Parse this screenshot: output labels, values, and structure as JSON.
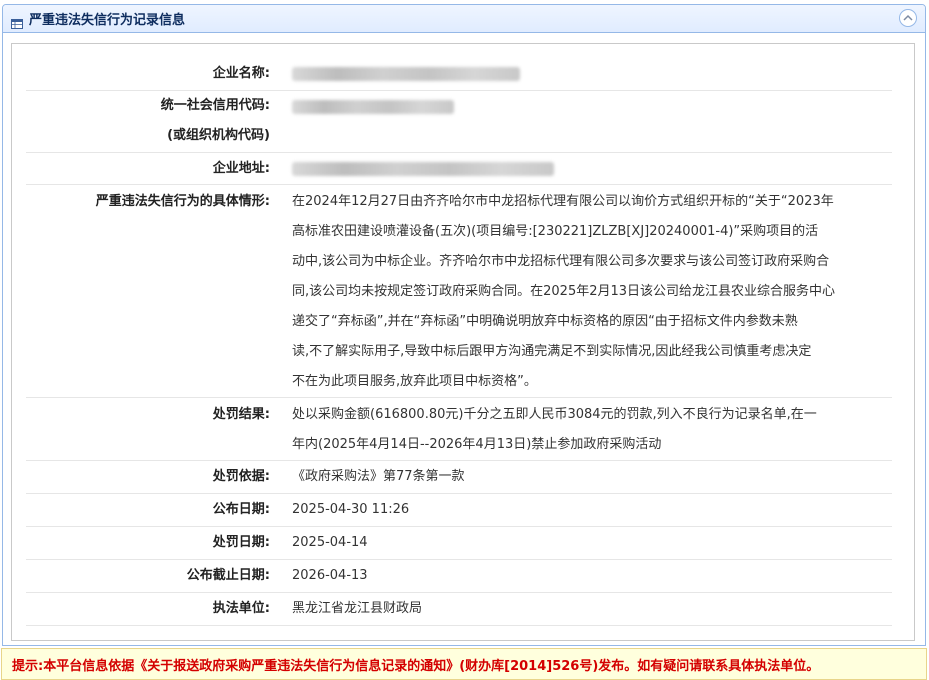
{
  "panel": {
    "title": "严重违法失信行为记录信息",
    "icon": "table-icon",
    "collapse_icon": "chevron-up-icon",
    "border_color": "#95b8e7"
  },
  "fields": [
    {
      "name": "company-name",
      "label": "企业名称:",
      "value": "",
      "redacted": true
    },
    {
      "name": "credit-code",
      "label": "统一社会信用代码:",
      "label2": "(或组织机构代码)",
      "value": "",
      "redacted": true
    },
    {
      "name": "address",
      "label": "企业地址:",
      "value": "",
      "redacted": true
    },
    {
      "name": "details",
      "label": "严重违法失信行为的具体情形:",
      "value_lines": [
        "在2024年12月27日由齐齐哈尔市中龙招标代理有限公司以询价方式组织开标的“关于“2023年",
        "高标准农田建设喷灌设备(五次)(项目编号:[230221]ZLZB[XJ]20240001-4)”采购项目的活",
        "动中,该公司为中标企业。齐齐哈尔市中龙招标代理有限公司多次要求与该公司签订政府采购合",
        "同,该公司均未按规定签订政府采购合同。在2025年2月13日该公司给龙江县农业综合服务中心",
        "递交了“弃标函”,并在“弃标函”中明确说明放弃中标资格的原因“由于招标文件内参数未熟",
        "读,不了解实际用子,导致中标后跟甲方沟通完满足不到实际情况,因此经我公司慎重考虑决定",
        "不在为此项目服务,放弃此项目中标资格”。"
      ]
    },
    {
      "name": "penalty-result",
      "label": "处罚结果:",
      "value_lines": [
        "处以采购金额(616800.80元)千分之五即人民币3084元的罚款,列入不良行为记录名单,在一",
        "年内(2025年4月14日--2026年4月13日)禁止参加政府采购活动"
      ]
    },
    {
      "name": "penalty-basis",
      "label": "处罚依据:",
      "value": "《政府采购法》第77条第一款"
    },
    {
      "name": "publish-date",
      "label": "公布日期:",
      "value": "2025-04-30 11:26"
    },
    {
      "name": "penalty-date",
      "label": "处罚日期:",
      "value": "2025-04-14"
    },
    {
      "name": "publish-end-date",
      "label": "公布截止日期:",
      "value": "2026-04-13"
    },
    {
      "name": "enforcement-unit",
      "label": "执法单位:",
      "value": "黑龙江省龙江县财政局"
    }
  ],
  "tip": {
    "text": "提示:本平台信息依据《关于报送政府采购严重违法失信行为信息记录的通知》(财办库[2014]526号)发布。如有疑问请联系具体执法单位。",
    "color": "#d40000",
    "background": "#ffffdd"
  }
}
